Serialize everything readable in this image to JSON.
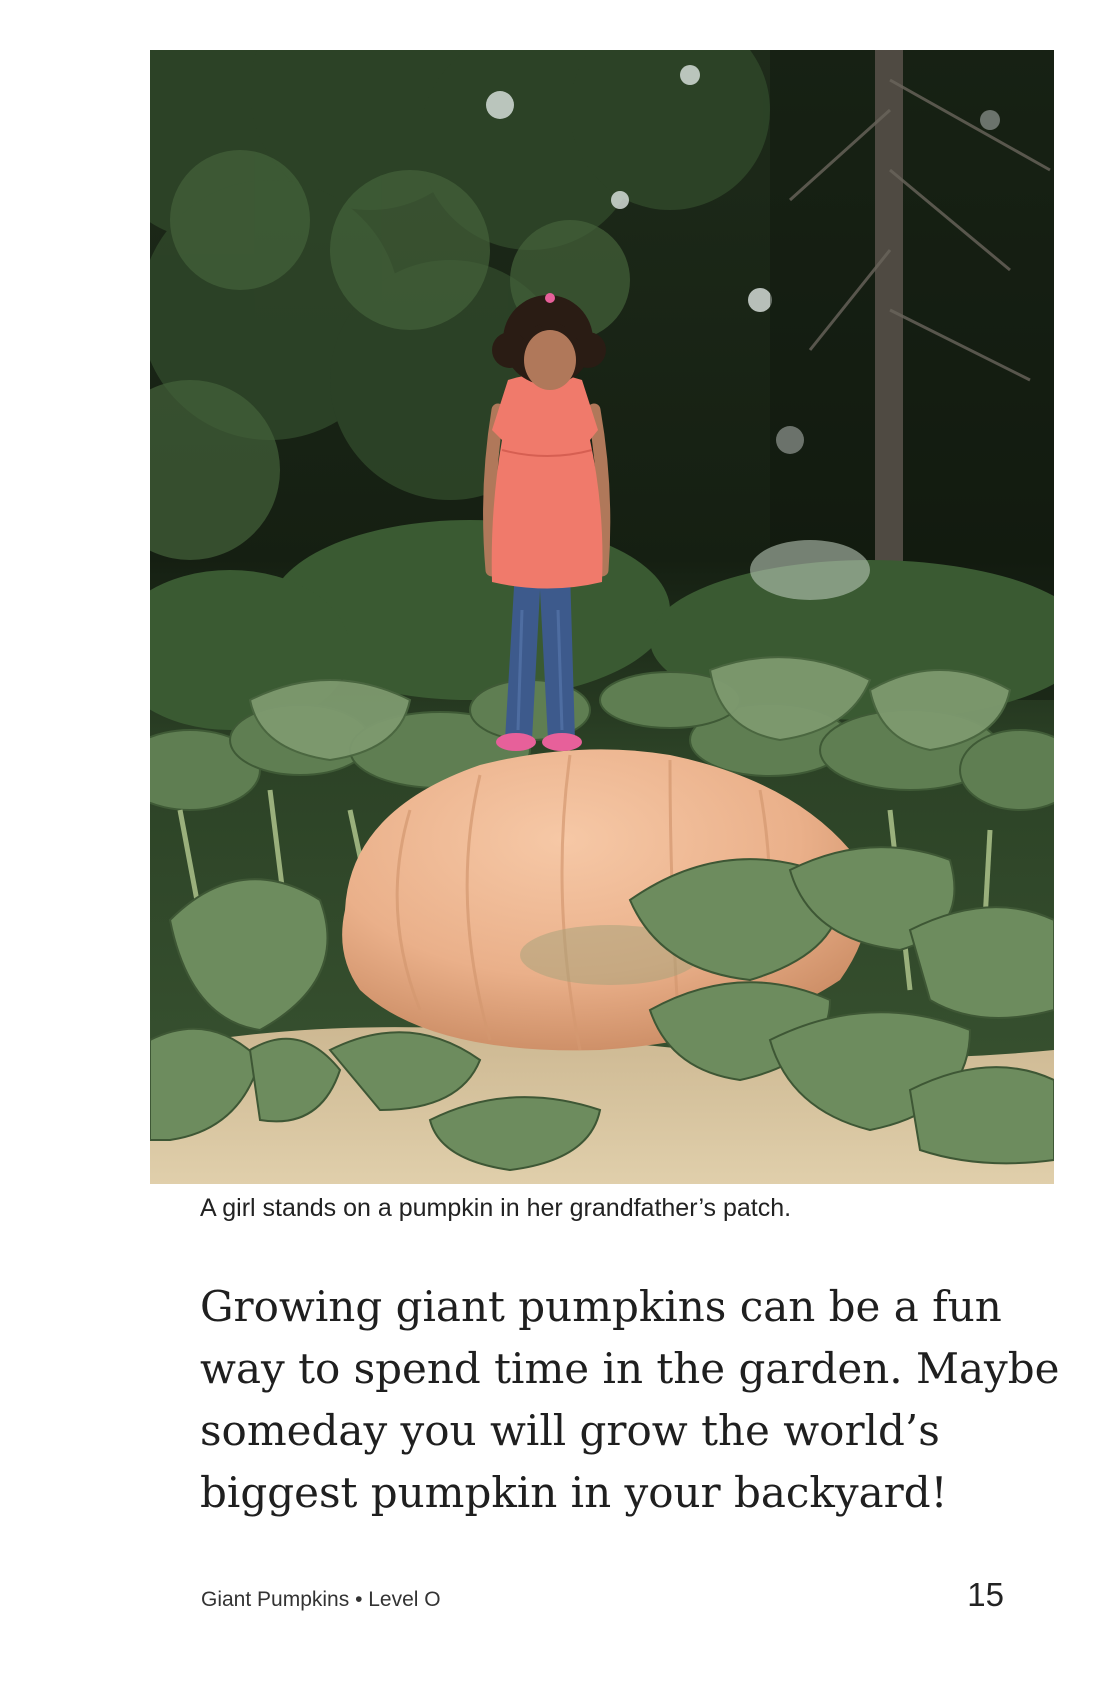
{
  "photo": {
    "alt": "",
    "palette": {
      "forest": "#1b2617",
      "foliage": "#3f5c34",
      "leaf": "#6b8a5c",
      "pumpkin": "#eab08a",
      "shirt": "#f07a6b",
      "jeans": "#3d5a8c",
      "hair": "#2a1c14",
      "skin": "#b0785a",
      "soil": "#d8c39c"
    }
  },
  "caption": "A girl stands on a pumpkin in her grandfather’s patch.",
  "body": {
    "lines": [
      "Growing giant pumpkins can be a fun",
      "way to spend time in the garden. Maybe",
      "someday you will grow the world’s",
      "biggest pumpkin in your backyard!"
    ]
  },
  "footer": {
    "title": "Giant Pumpkins • Level O",
    "page_number": "15"
  }
}
